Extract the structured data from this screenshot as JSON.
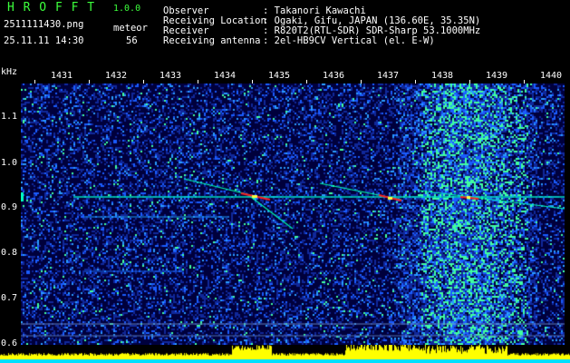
{
  "header": {
    "logo": "H R O F F T",
    "version": "1.0.0",
    "filename": "2511111430.png",
    "datetime": "25.11.11 14:30",
    "meteor_label": "meteor",
    "meteor_count": "56",
    "fields": [
      {
        "label": "Observer",
        "value": ": Takanori Kawachi"
      },
      {
        "label": "Receiving Location",
        "value": ": Ogaki, Gifu, JAPAN (136.60E, 35.35N)"
      },
      {
        "label": "Receiver",
        "value": ": R820T2(RTL-SDR) SDR-Sharp 53.1000MHz"
      },
      {
        "label": "Receiving antenna",
        "value": ": 2el-HB9CV Vertical (el. E-W)"
      }
    ]
  },
  "axes": {
    "y_unit": "kHz",
    "x_ticks": [
      "1431",
      "1432",
      "1433",
      "1434",
      "1435",
      "1436",
      "1437",
      "1438",
      "1439",
      "1440"
    ],
    "y_ticks": [
      "1.1",
      "1.0",
      "0.9",
      "0.8",
      "0.7",
      "0.6"
    ],
    "y_range": [
      0.58,
      1.17
    ]
  },
  "colors": {
    "background": "#00003c",
    "noise": "#1a3cff",
    "trace": "#00ffc8",
    "meteor_head": "#ff2a2a",
    "bar_yellow": "#ffff00",
    "bar_cyan": "#00e0ff"
  }
}
